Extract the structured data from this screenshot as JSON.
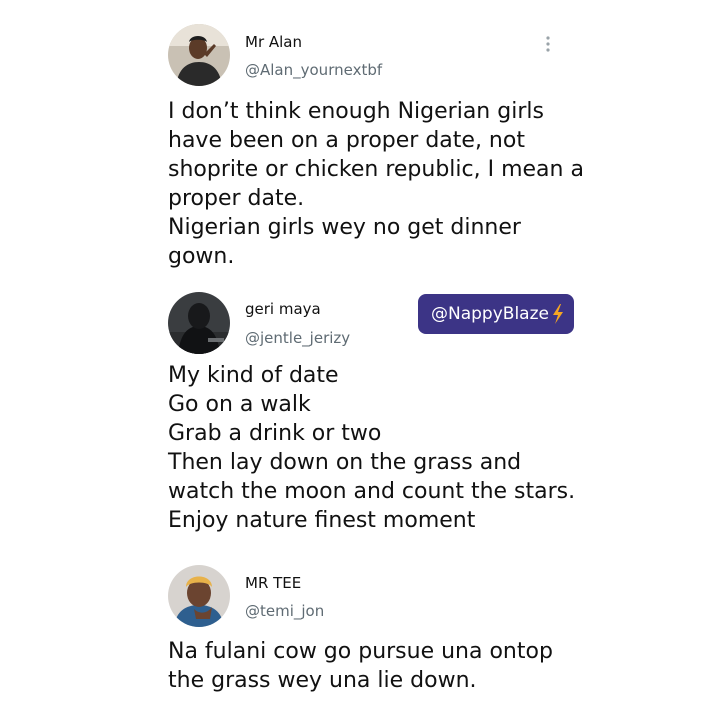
{
  "tweets": [
    {
      "name": "Mr Alan",
      "handle": "@Alan_yournextbf",
      "text": "I don’t think enough Nigerian girls\nhave been on a proper date, not\nshoprite or chicken republic, I mean a\nproper date.\nNigerian girls wey no get dinner\ngown.",
      "avatar_icon": "profile-photo",
      "menu_icon": "more-vertical-icon"
    },
    {
      "name": "geri maya",
      "handle": "@jentle_jerizy",
      "text": "My kind of date\nGo on a walk\nGrab a drink or two\nThen lay down on the grass and\nwatch the moon and count the stars.\nEnjoy nature finest moment",
      "avatar_icon": "profile-photo"
    },
    {
      "name": "MR TEE",
      "handle": "@temi_jon",
      "text": "Na fulani cow go pursue una ontop\nthe grass wey una lie down.",
      "avatar_icon": "profile-photo"
    }
  ],
  "watermark": {
    "label": "@NappyBlaze",
    "icon": "lightning-bolt-icon",
    "background": "#3c3486",
    "icon_color": "#f5a623"
  },
  "colors": {
    "text": "#111111",
    "handle": "#5f6b73",
    "background": "#ffffff"
  }
}
